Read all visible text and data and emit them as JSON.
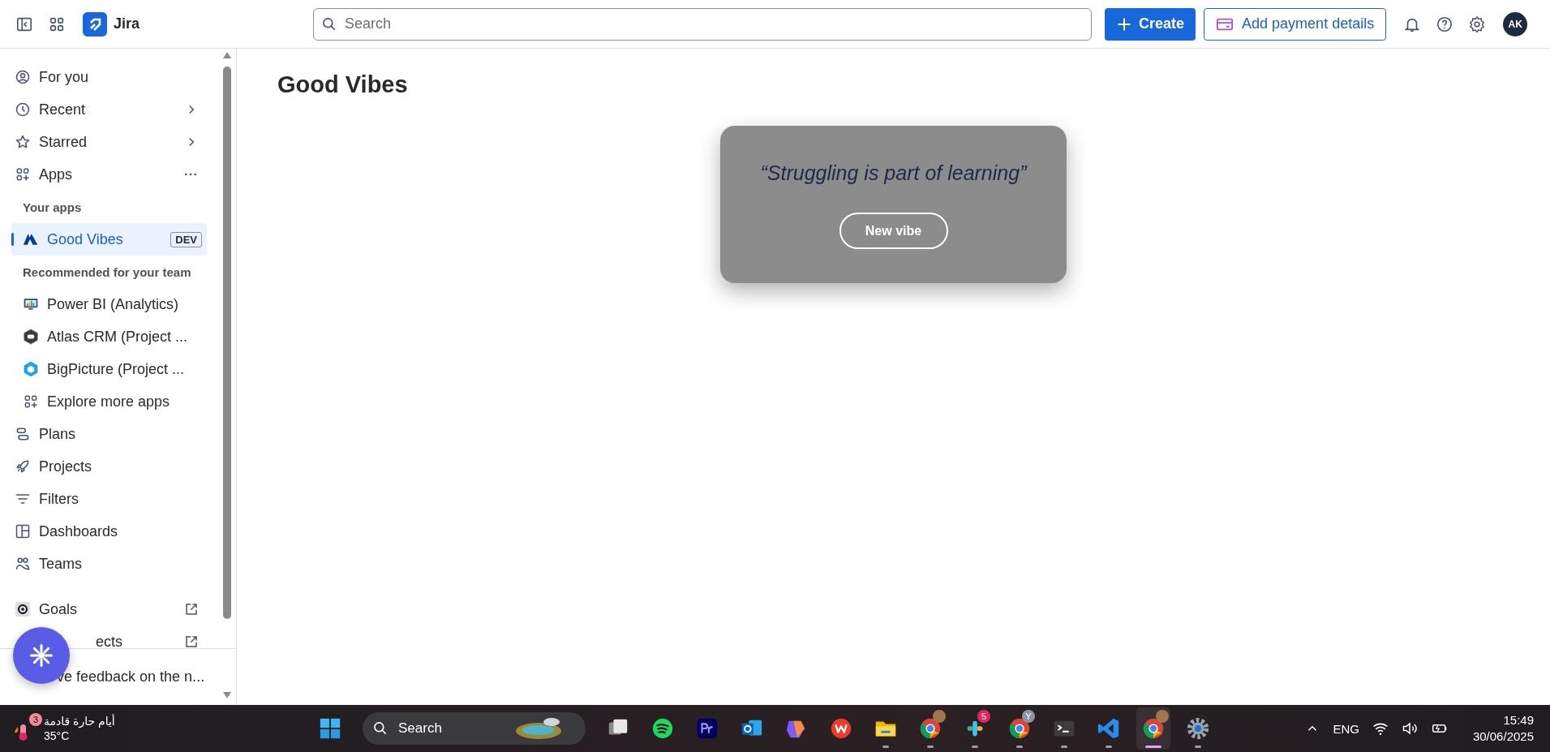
{
  "top_bar": {
    "app_name": "Jira",
    "search": {
      "placeholder": "Search"
    },
    "create_button": "Create",
    "payment_button": "Add payment details",
    "avatar": "AK"
  },
  "sidebar": {
    "items": [
      {
        "kind": "nav",
        "label": "For you"
      },
      {
        "kind": "nav_chevron",
        "label": "Recent"
      },
      {
        "kind": "nav_chevron",
        "label": "Starred"
      },
      {
        "kind": "nav_more",
        "label": "Apps"
      },
      {
        "kind": "heading",
        "label": "Your apps"
      },
      {
        "kind": "app",
        "label": "Good Vibes",
        "badge": "DEV",
        "selected": true
      },
      {
        "kind": "heading",
        "label": "Recommended for your team"
      },
      {
        "kind": "app",
        "label": "Power BI (Analytics)",
        "selected": false
      },
      {
        "kind": "app",
        "label": "Atlas CRM (Project ...",
        "selected": false
      },
      {
        "kind": "app",
        "label": "BigPicture (Project ...",
        "selected": false
      },
      {
        "kind": "app",
        "label": "Explore more apps",
        "selected": false
      },
      {
        "kind": "nav",
        "label": "Plans"
      },
      {
        "kind": "nav",
        "label": "Projects"
      },
      {
        "kind": "nav",
        "label": "Filters"
      },
      {
        "kind": "nav",
        "label": "Dashboards"
      },
      {
        "kind": "nav",
        "label": "Teams"
      }
    ],
    "bottom_items": [
      {
        "kind": "nav_external",
        "label": "Goals"
      },
      {
        "kind": "covered_external",
        "label": "ects"
      }
    ],
    "feedback": "ve feedback on the n..."
  },
  "page": {
    "title": "Good Vibes",
    "quote": "“Struggling is part of learning”",
    "button": "New vibe"
  },
  "taskbar": {
    "weather": {
      "badge": "3",
      "text": "أيام حارة قادمة",
      "temp": "35°C"
    },
    "search": {
      "placeholder": "Search"
    },
    "apps": [
      {
        "kind": "taskview",
        "running": false,
        "active": false
      },
      {
        "kind": "spotify",
        "running": false,
        "active": false
      },
      {
        "kind": "premiere",
        "running": false,
        "active": false
      },
      {
        "kind": "outlook",
        "running": false,
        "active": false
      },
      {
        "kind": "m365",
        "running": false,
        "active": false
      },
      {
        "kind": "wps",
        "running": false,
        "active": false
      },
      {
        "kind": "files",
        "running": true,
        "active": false
      },
      {
        "kind": "chrome_profile",
        "running": true,
        "active": false
      },
      {
        "kind": "slack",
        "running": true,
        "active": false,
        "badge": "5"
      },
      {
        "kind": "chrome",
        "running": true,
        "active": false,
        "badge": "Y"
      },
      {
        "kind": "terminal",
        "running": true,
        "active": false
      },
      {
        "kind": "vscode",
        "running": true,
        "active": false
      },
      {
        "kind": "chrome_profile",
        "running": true,
        "active": true
      },
      {
        "kind": "settings",
        "running": true,
        "active": false
      }
    ],
    "language": "ENG",
    "time": "15:49",
    "date": "30/06/2025"
  }
}
